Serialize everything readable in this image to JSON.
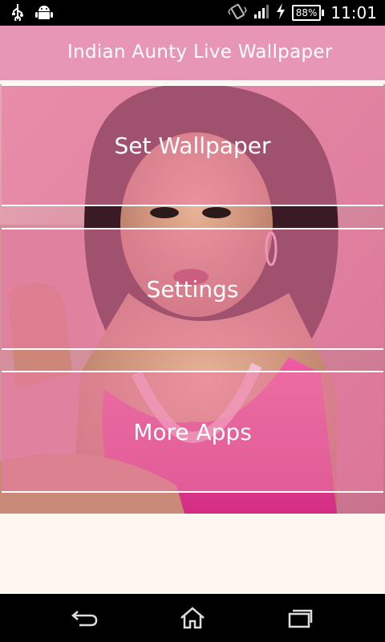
{
  "status_bar": {
    "time": "11:01",
    "battery": "88%",
    "icons": [
      "usb-icon",
      "android-debug-icon",
      "vibrate-icon",
      "signal-icon",
      "charging-icon",
      "battery-icon"
    ]
  },
  "app_bar": {
    "title": "Indian Aunty Live Wallpaper",
    "color": "#e896b5"
  },
  "menu": {
    "set_wallpaper": "Set Wallpaper",
    "settings": "Settings",
    "more_apps": "More Apps"
  },
  "nav_bar": {
    "icons": [
      "back-icon",
      "home-icon",
      "recent-apps-icon"
    ]
  }
}
